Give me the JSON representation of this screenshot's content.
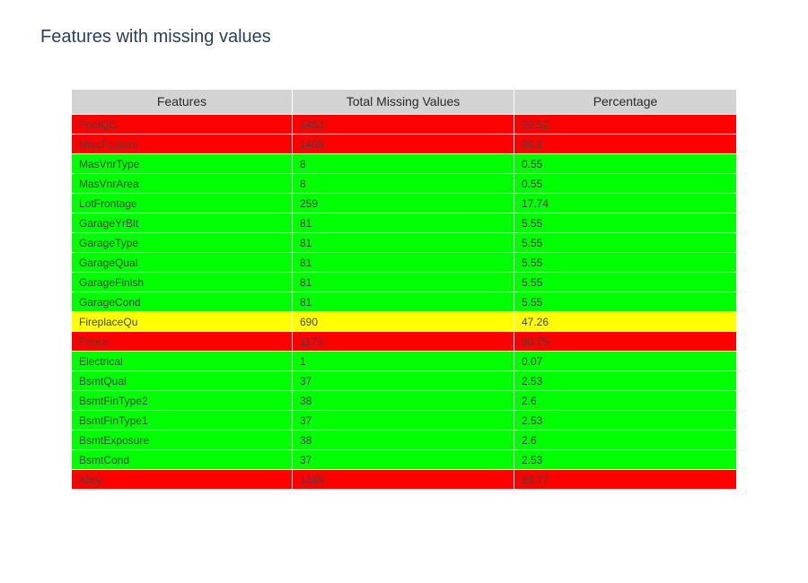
{
  "title": "Features with missing values",
  "colors": {
    "header_fill": "#d3d3d3",
    "high": "#ff0000",
    "medium": "#ffff00",
    "low": "#00ff00",
    "title_text": "#2a3f5f",
    "cell_text": "#444444"
  },
  "chart_data": {
    "type": "table",
    "columns": [
      "Features",
      "Total Missing Values",
      "Percentage"
    ],
    "rows": [
      {
        "feature": "PoolQC",
        "missing": "1453",
        "percentage": "99.52",
        "level": "high"
      },
      {
        "feature": "MiscFeature",
        "missing": "1406",
        "percentage": "96.3",
        "level": "high"
      },
      {
        "feature": "MasVnrType",
        "missing": "8",
        "percentage": "0.55",
        "level": "low"
      },
      {
        "feature": "MasVnrArea",
        "missing": "8",
        "percentage": "0.55",
        "level": "low"
      },
      {
        "feature": "LotFrontage",
        "missing": "259",
        "percentage": "17.74",
        "level": "low"
      },
      {
        "feature": "GarageYrBlt",
        "missing": "81",
        "percentage": "5.55",
        "level": "low"
      },
      {
        "feature": "GarageType",
        "missing": "81",
        "percentage": "5.55",
        "level": "low"
      },
      {
        "feature": "GarageQual",
        "missing": "81",
        "percentage": "5.55",
        "level": "low"
      },
      {
        "feature": "GarageFinish",
        "missing": "81",
        "percentage": "5.55",
        "level": "low"
      },
      {
        "feature": "GarageCond",
        "missing": "81",
        "percentage": "5.55",
        "level": "low"
      },
      {
        "feature": "FireplaceQu",
        "missing": "690",
        "percentage": "47.26",
        "level": "medium"
      },
      {
        "feature": "Fence",
        "missing": "1179",
        "percentage": "80.75",
        "level": "high"
      },
      {
        "feature": "Electrical",
        "missing": "1",
        "percentage": "0.07",
        "level": "low"
      },
      {
        "feature": "BsmtQual",
        "missing": "37",
        "percentage": "2.53",
        "level": "low"
      },
      {
        "feature": "BsmtFinType2",
        "missing": "38",
        "percentage": "2.6",
        "level": "low"
      },
      {
        "feature": "BsmtFinType1",
        "missing": "37",
        "percentage": "2.53",
        "level": "low"
      },
      {
        "feature": "BsmtExposure",
        "missing": "38",
        "percentage": "2.6",
        "level": "low"
      },
      {
        "feature": "BsmtCond",
        "missing": "37",
        "percentage": "2.53",
        "level": "low"
      },
      {
        "feature": "Alley",
        "missing": "1369",
        "percentage": "93.77",
        "level": "high"
      }
    ]
  }
}
